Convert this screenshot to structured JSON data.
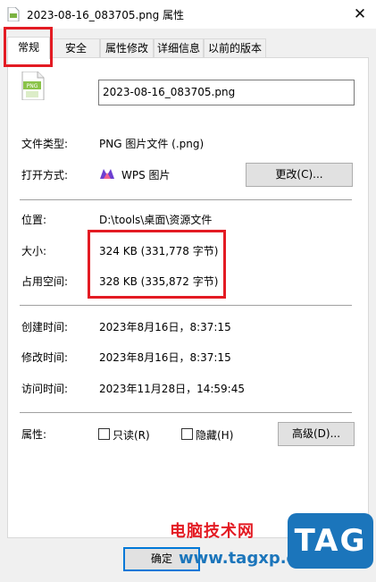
{
  "window": {
    "title": "2023-08-16_083705.png 属性",
    "close_glyph": "✕"
  },
  "tabs": [
    {
      "label": "常规",
      "active": true
    },
    {
      "label": "安全"
    },
    {
      "label": "属性修改"
    },
    {
      "label": "详细信息"
    },
    {
      "label": "以前的版本"
    }
  ],
  "file": {
    "icon_text": "PNG",
    "name": "2023-08-16_083705.png"
  },
  "general": {
    "file_type_label": "文件类型:",
    "file_type_value": "PNG 图片文件 (.png)",
    "open_with_label": "打开方式:",
    "open_with_value": "WPS 图片",
    "change_button": "更改(C)...",
    "location_label": "位置:",
    "location_value": "D:\\tools\\桌面\\资源文件",
    "size_label": "大小:",
    "size_value": "324 KB (331,778 字节)",
    "disk_size_label": "占用空间:",
    "disk_size_value": "328 KB (335,872 字节)",
    "created_label": "创建时间:",
    "created_value": "2023年8月16日，8:37:15",
    "modified_label": "修改时间:",
    "modified_value": "2023年8月16日，8:37:15",
    "accessed_label": "访问时间:",
    "accessed_value": "2023年11月28日，14:59:45",
    "attributes_label": "属性:",
    "readonly_label": "只读(R)",
    "hidden_label": "隐藏(H)",
    "advanced_button": "高级(D)..."
  },
  "footer": {
    "ok_button": "确定"
  },
  "watermark": {
    "site_name": "电脑技术网",
    "url": "www.tagxp.com",
    "logo_text": "TAG"
  },
  "colors": {
    "highlight": "#e31b23",
    "accent": "#0078d7",
    "brand": "#1b75bb"
  }
}
